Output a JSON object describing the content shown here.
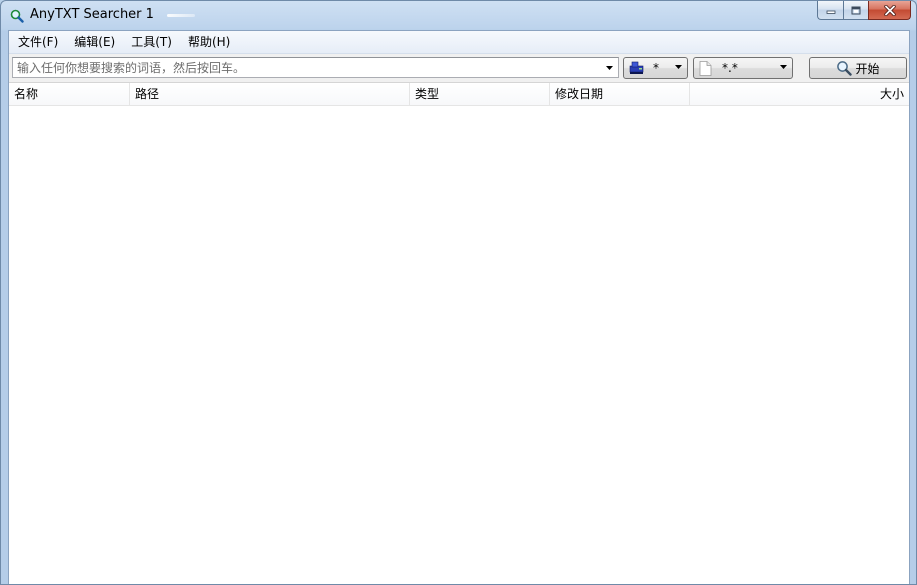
{
  "window": {
    "title": "AnyTXT Searcher 1"
  },
  "menu": {
    "items": [
      {
        "label": "文件(F)"
      },
      {
        "label": "编辑(E)"
      },
      {
        "label": "工具(T)"
      },
      {
        "label": "帮助(H)"
      }
    ]
  },
  "toolbar": {
    "search_placeholder": "输入任何你想要搜索的词语，然后按回车。",
    "search_value": "",
    "drive_value": "*",
    "extension_value": "*.*",
    "start_label": "开始"
  },
  "results": {
    "columns": [
      {
        "label": "名称"
      },
      {
        "label": "路径"
      },
      {
        "label": "类型"
      },
      {
        "label": "修改日期"
      },
      {
        "label": "大小"
      }
    ],
    "rows": []
  },
  "icons": {
    "app": "magnifier-icon",
    "drive": "drive-icon",
    "file": "file-icon",
    "search": "magnifier-icon"
  },
  "colors": {
    "titlebar": "#bcd3ec",
    "close_button": "#c34a32",
    "client_bg": "#f0f0f0"
  }
}
